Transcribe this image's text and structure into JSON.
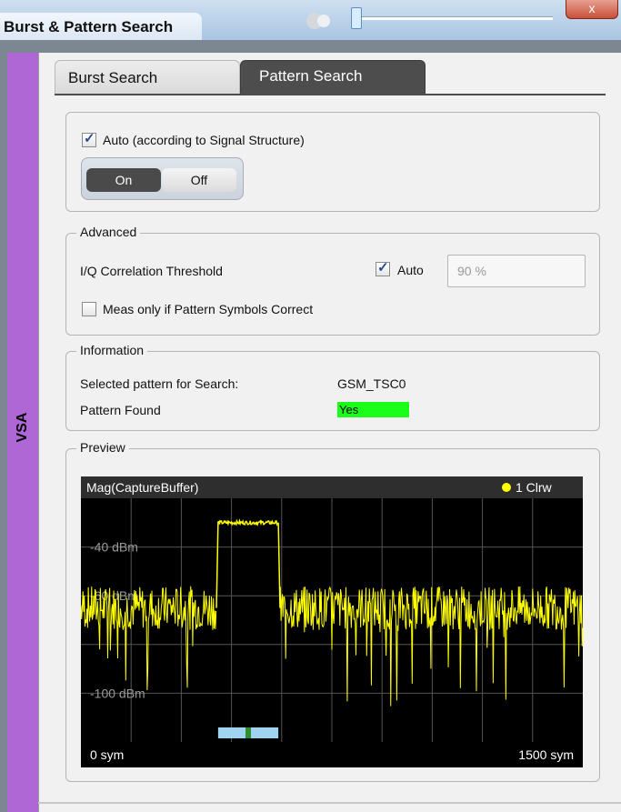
{
  "dialog": {
    "title": "Burst & Pattern Search",
    "close_glyph": "x",
    "side_label": "VSA"
  },
  "tabs": [
    {
      "label": "Burst Search",
      "active": false
    },
    {
      "label": "Pattern Search",
      "active": true
    }
  ],
  "auto_section": {
    "auto_label": "Auto (according to Signal Structure)",
    "auto_checked": true,
    "toggle_on_label": "On",
    "toggle_off_label": "Off",
    "toggle_selected": "On"
  },
  "advanced": {
    "legend": "Advanced",
    "threshold_label": "I/Q Correlation Threshold",
    "threshold_auto_label": "Auto",
    "threshold_auto_checked": true,
    "threshold_value": "90 %",
    "meas_only_label": "Meas only if Pattern Symbols Correct",
    "meas_only_checked": false
  },
  "information": {
    "legend": "Information",
    "selected_pattern_label": "Selected pattern for Search:",
    "selected_pattern_value": "GSM_TSC0",
    "pattern_found_label": "Pattern Found",
    "pattern_found_value": "Yes"
  },
  "preview": {
    "legend": "Preview",
    "plot_title": "Mag(CaptureBuffer)",
    "trace_label": "1 Clrw",
    "ref_labels": [
      "-40 dBm",
      "-60 dBm",
      "-100 dBm"
    ],
    "x_start": "0 sym",
    "x_stop": "1500 sym"
  },
  "colors": {
    "side_bar": "#b067d6",
    "active_tab": "#4d4d4d",
    "trace": "#ffff00",
    "pattern_found": "#1aff1a",
    "pattern_marker": "#9fd3f0",
    "pattern_marker_center": "#2f8f2f"
  },
  "chart_data": {
    "type": "line",
    "title": "Mag(CaptureBuffer)",
    "xlabel": "",
    "ylabel": "",
    "xlim": [
      0,
      1500
    ],
    "ylim": [
      -120,
      -20
    ],
    "x_unit": "sym",
    "y_unit": "dBm",
    "series": [
      {
        "name": "1 Clrw",
        "x": [
          0,
          300,
          405,
          410,
          590,
          595,
          700,
          1500
        ],
        "values": [
          -65,
          -65,
          -65,
          -30,
          -30,
          -65,
          -65,
          -65
        ]
      }
    ]
  }
}
